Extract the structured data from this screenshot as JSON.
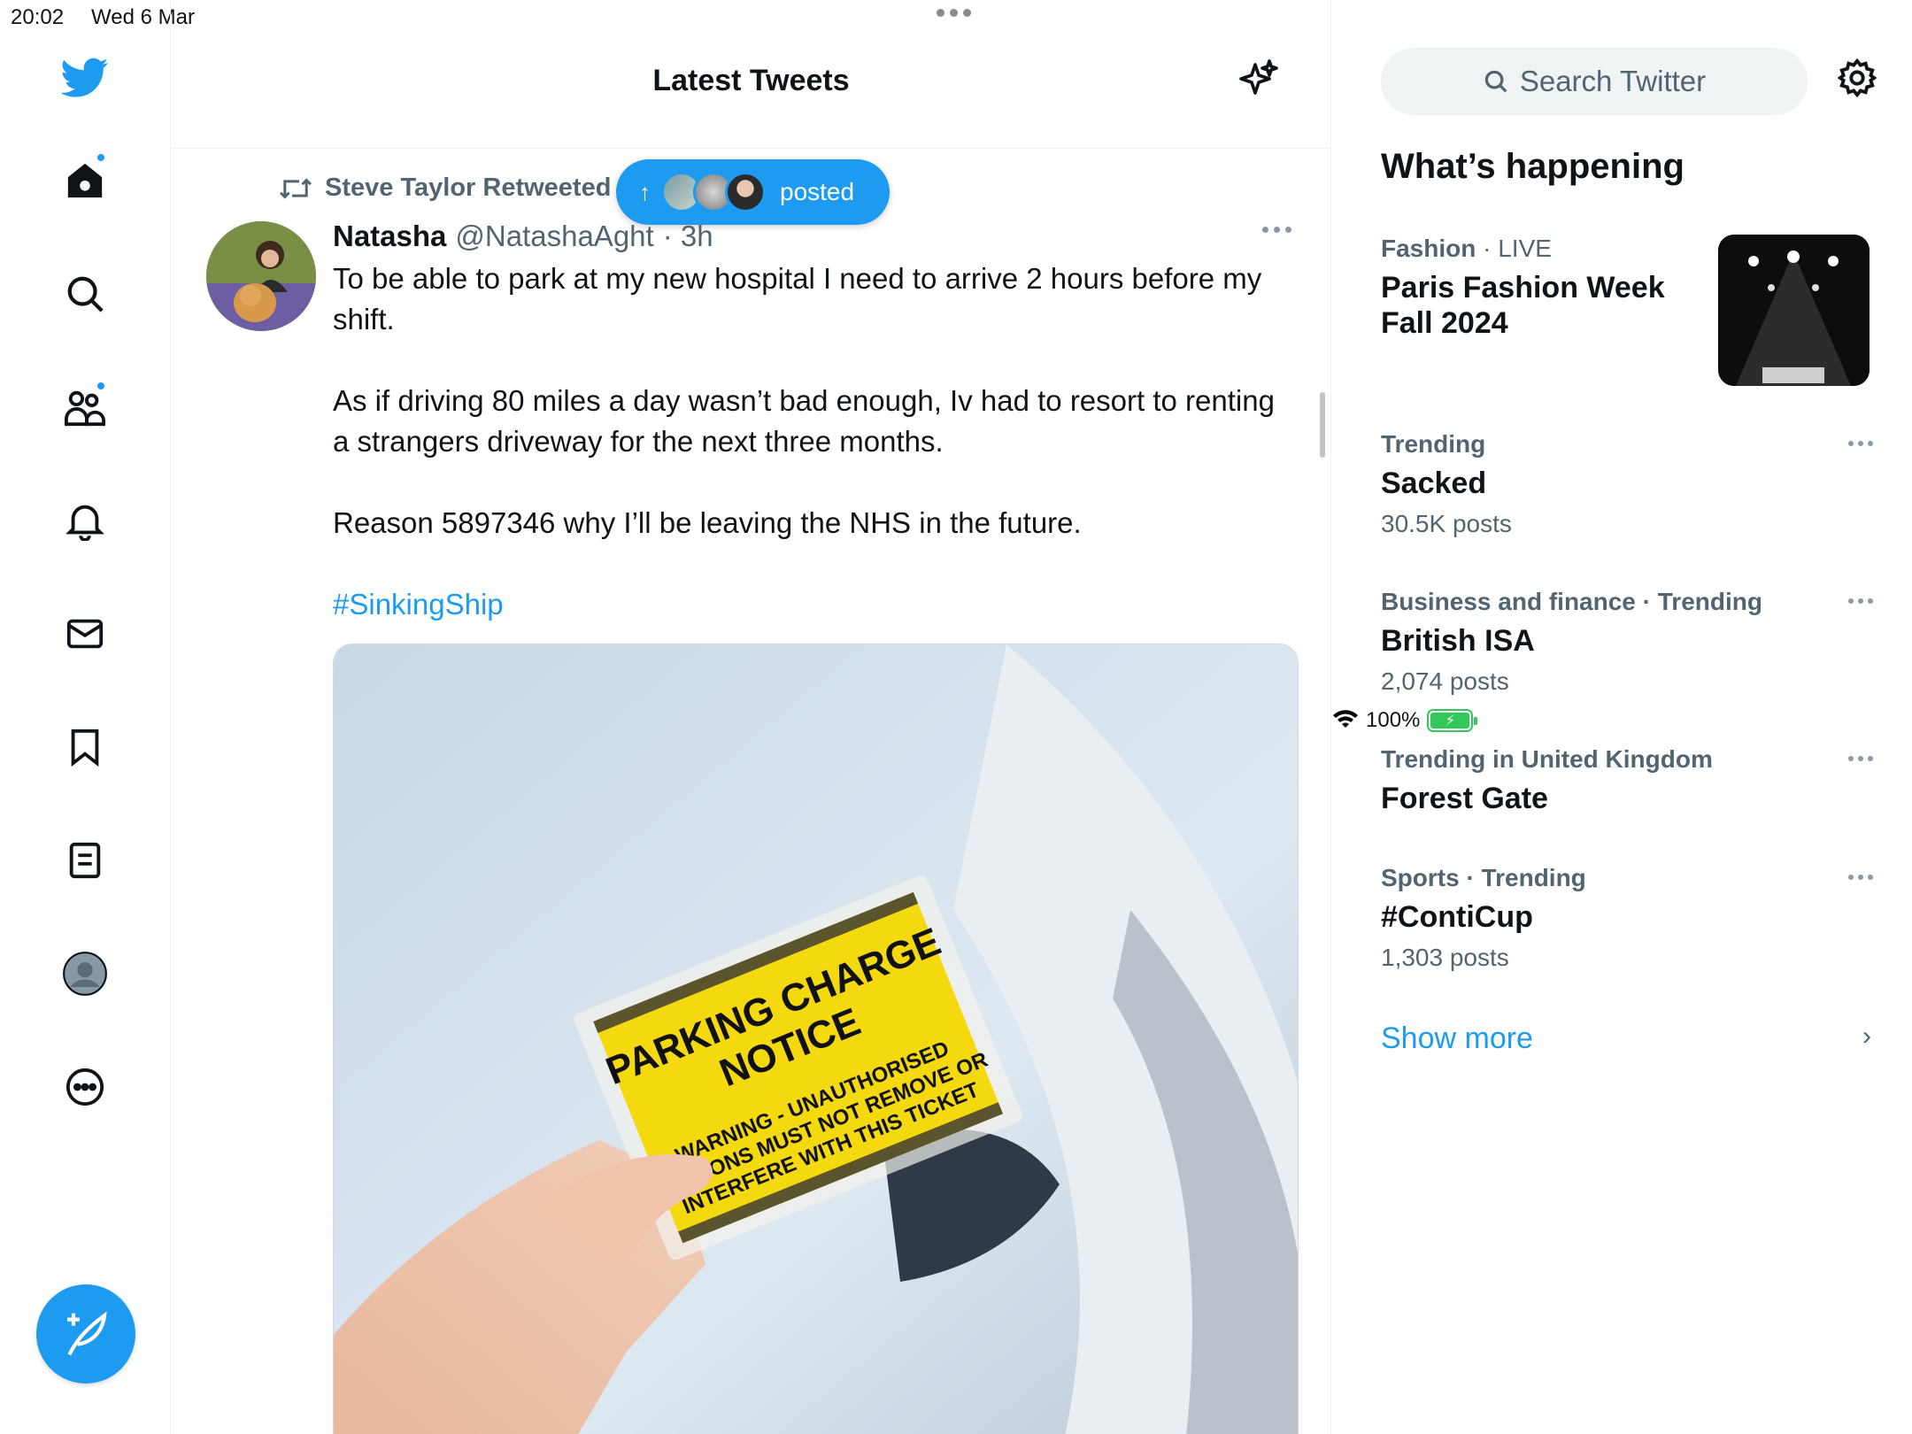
{
  "status_bar": {
    "time": "20:02",
    "date": "Wed 6 Mar",
    "battery": "100%"
  },
  "nav": {
    "items": [
      "home-icon",
      "search-icon",
      "communities-icon",
      "notifications-icon",
      "messages-icon",
      "bookmarks-icon",
      "lists-icon",
      "profile-icon",
      "more-icon"
    ]
  },
  "main": {
    "title": "Latest Tweets",
    "new_posts_pill": "posted",
    "tweet": {
      "retweeted_by": "Steve Taylor Retweeted",
      "name": "Natasha",
      "handle": "@NatashaAght",
      "time": "· 3h",
      "paragraph_1": "To be able to park at my new hospital I need to arrive 2 hours before my shift.",
      "paragraph_2": "As if driving 80 miles a day wasn’t bad enough, Iv had to resort to renting a strangers driveway for the next three months.",
      "paragraph_3": "Reason 5897346 why I’ll be leaving the NHS in the future.",
      "hashtag": "#SinkingShip",
      "image_text": {
        "line1": "PARKING CHARGE",
        "line2": "NOTICE",
        "line3": "WARNING - UNAUTHORISED",
        "line4": "PERSONS MUST NOT REMOVE OR",
        "line5": "INTERFERE WITH THIS TICKET"
      }
    }
  },
  "sidebar": {
    "search_placeholder": "Search Twitter",
    "whats_happening": "What’s happening",
    "trends": [
      {
        "category": "Fashion",
        "extra": " · LIVE",
        "topic": "Paris Fashion Week Fall 2024",
        "count": ""
      },
      {
        "category": "Trending",
        "extra": "",
        "topic": "Sacked",
        "count": "30.5K posts"
      },
      {
        "category": "Business and finance · Trending",
        "extra": "",
        "topic": "British ISA",
        "count": "2,074 posts"
      },
      {
        "category": "Trending in United Kingdom",
        "extra": "",
        "topic": "Forest Gate",
        "count": ""
      },
      {
        "category": "Sports · Trending",
        "extra": "",
        "topic": "#ContiCup",
        "count": "1,303 posts"
      }
    ],
    "show_more": "Show more"
  },
  "colors": {
    "accent": "#1d9bf0",
    "secondary_text": "#536471",
    "primary_text": "#0f1419"
  }
}
